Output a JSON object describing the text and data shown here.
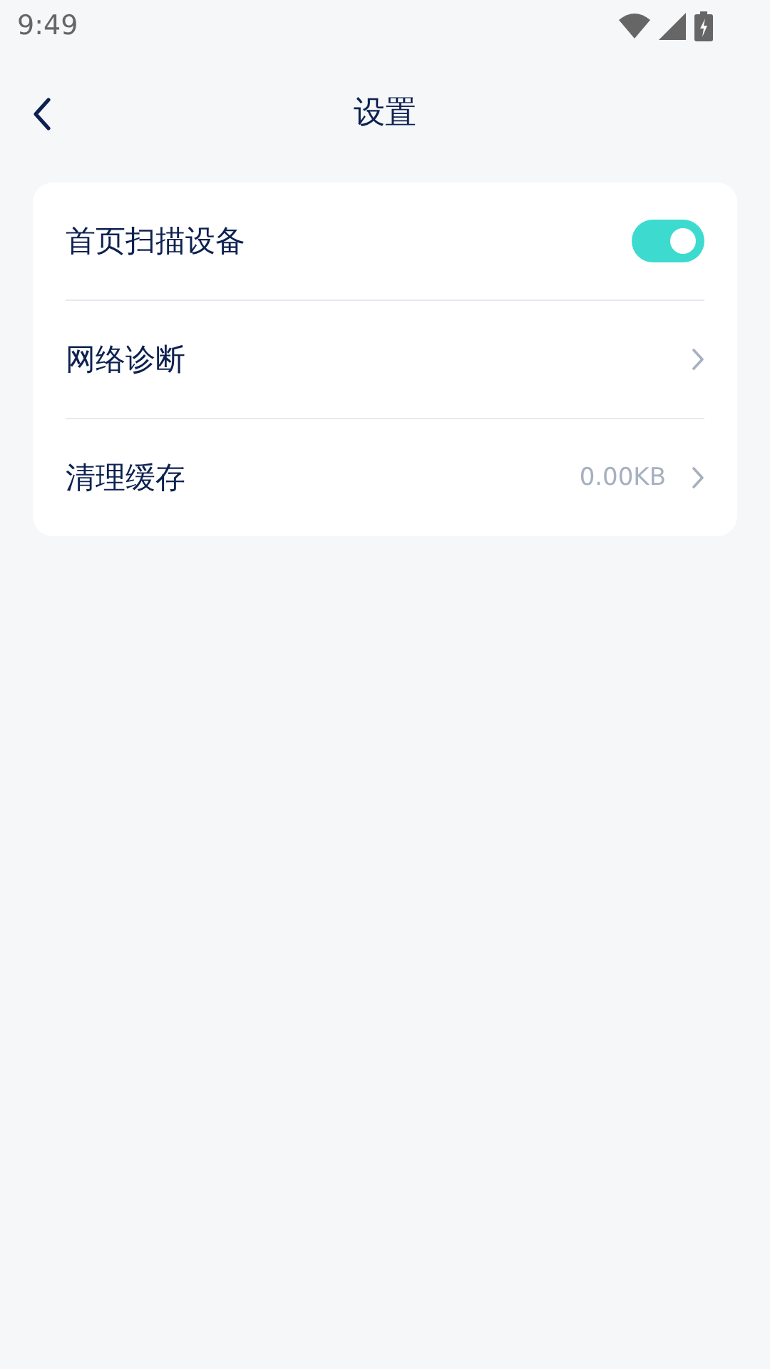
{
  "status_bar": {
    "time": "9:49"
  },
  "header": {
    "title": "设置"
  },
  "settings": [
    {
      "kind": "toggle",
      "label": "首页扫描设备",
      "on": true
    },
    {
      "kind": "link",
      "label": "网络诊断"
    },
    {
      "kind": "link",
      "label": "清理缓存",
      "value": "0.00KB"
    }
  ]
}
